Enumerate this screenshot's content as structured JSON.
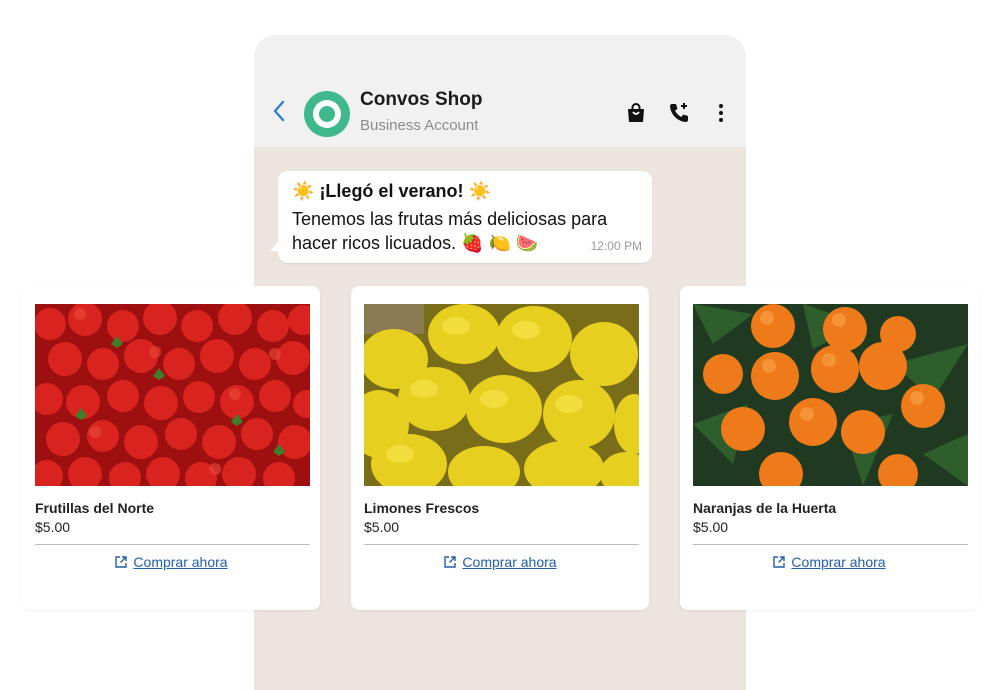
{
  "header": {
    "title": "Convos Shop",
    "subtitle": "Business Account",
    "icons": [
      "back-arrow-icon",
      "shopping-bag-icon",
      "add-call-icon",
      "more-vert-icon"
    ],
    "accent_color": "#3fb88e",
    "back_color": "#2f7fd1"
  },
  "message": {
    "headline": "¡Llegó el verano!",
    "emoji_sun": "☀️",
    "body": "Tenemos las frutas más deliciosas para hacer ricos licuados.",
    "emojis": "🍓 🍋 🍉",
    "time": "12:00 PM"
  },
  "products": [
    {
      "name": "Frutillas del Norte",
      "price": "$5.00",
      "cta": "Comprar ahora",
      "image": "strawberries"
    },
    {
      "name": "Limones Frescos",
      "price": "$5.00",
      "cta": "Comprar ahora",
      "image": "lemons"
    },
    {
      "name": "Naranjas de la Huerta",
      "price": "$5.00",
      "cta": "Comprar ahora",
      "image": "oranges"
    }
  ],
  "colors": {
    "link": "#1f5fae",
    "chat_bg": "#ebe5dd"
  }
}
